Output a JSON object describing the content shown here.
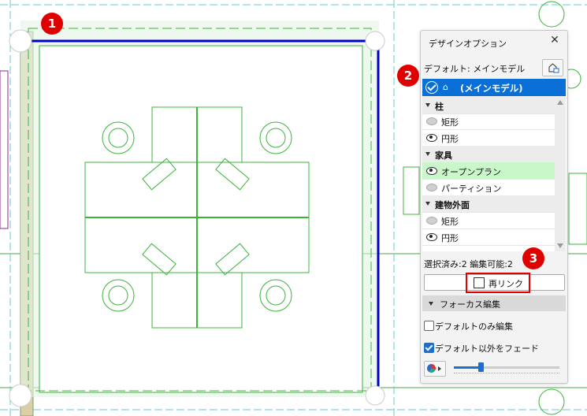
{
  "panel": {
    "title": "デザインオプション",
    "default_label": "デフォルト: メインモデル",
    "selected_option": "(メインモデル)",
    "groups": [
      {
        "name": "柱",
        "items": [
          {
            "label": "矩形",
            "visible": false
          },
          {
            "label": "円形",
            "visible": true
          }
        ]
      },
      {
        "name": "家具",
        "items": [
          {
            "label": "オープンプラン",
            "visible": true,
            "highlighted": true
          },
          {
            "label": "パーティション",
            "visible": false
          }
        ]
      },
      {
        "name": "建物外面",
        "items": [
          {
            "label": "矩形",
            "visible": false
          },
          {
            "label": "円形",
            "visible": true
          }
        ]
      }
    ],
    "status": "選択済み:2 編集可能:2",
    "relink_label": "再リンク",
    "focus_label": "フォーカス編集",
    "default_only_edit": "デフォルトのみ編集",
    "default_only_checked": false,
    "fade_others": "デフォルト以外をフェード",
    "fade_checked": true,
    "fade_level": 0.25
  },
  "badges": [
    "1",
    "2",
    "3"
  ],
  "icons": {
    "close": "close-icon",
    "house": "house-icon",
    "relink": "relink-icon",
    "pie": "color-pie-icon"
  },
  "colors": {
    "selected": "#0a70d8",
    "highlight": "#c9f7c9",
    "badge": "#e00000",
    "wall": "#0000c8",
    "drawing": "#3cb43c"
  }
}
